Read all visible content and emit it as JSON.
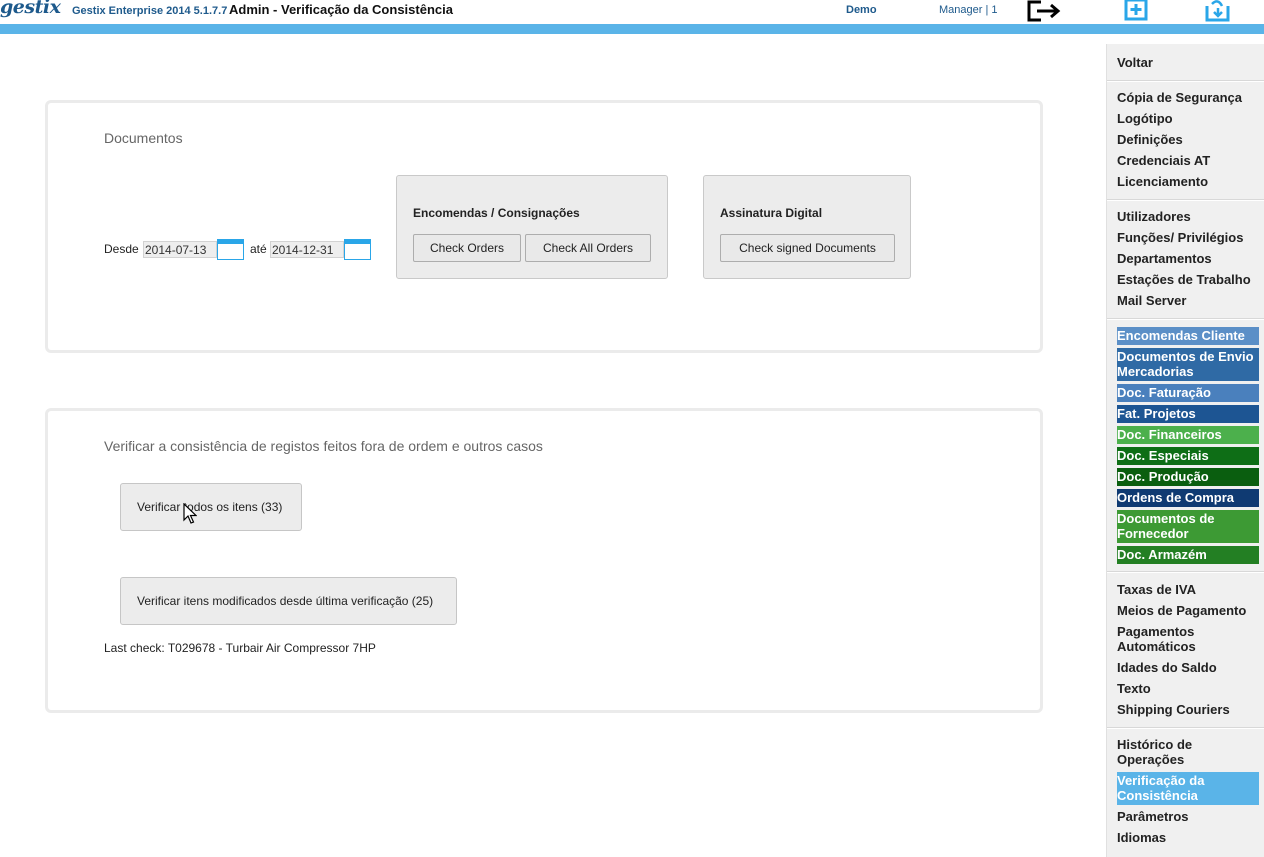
{
  "header": {
    "logo": "gestix",
    "app_version": "Gestix Enterprise 2014 5.1.7.7",
    "page_title": "Admin - Verificação da Consistência",
    "company": "Demo",
    "user": "Manager | 1",
    "icons": [
      "logout-icon",
      "new-window-icon",
      "sync-icon"
    ]
  },
  "documents_panel": {
    "title": "Documentos",
    "from_label": "Desde",
    "from_date": "2014-07-13",
    "to_label": "até",
    "to_date": "2014-12-31",
    "orders_group": {
      "title": "Encomendas / Consignações",
      "check_orders": "Check Orders",
      "check_all_orders": "Check All Orders"
    },
    "signature_group": {
      "title": "Assinatura Digital",
      "check_signed": "Check signed Documents"
    }
  },
  "consistency_panel": {
    "title": "Verificar a consistência de registos feitos fora de ordem e outros casos",
    "verify_all": "Verificar todos os itens (33)",
    "verify_modified": "Verificar itens modificados desde última verificação (25)",
    "last_check": "Last check: T029678 - Turbair Air Compressor 7HP"
  },
  "sidebar": {
    "back": "Voltar",
    "group1": [
      "Cópia de Segurança",
      "Logótipo",
      "Definições",
      "Credenciais AT",
      "Licenciamento"
    ],
    "group2": [
      "Utilizadores",
      "Funções/ Privilégios",
      "Departamentos",
      "Estações de Trabalho",
      "Mail Server"
    ],
    "group3": [
      {
        "label": "Encomendas Cliente",
        "color": "#5b8fc7"
      },
      {
        "label": "Documentos de Envio Mercadorias",
        "color": "#2f6aa5"
      },
      {
        "label": "Doc. Faturação",
        "color": "#4a80bd"
      },
      {
        "label": "Fat. Projetos",
        "color": "#1d5593"
      },
      {
        "label": "Doc. Financeiros",
        "color": "#4cb04c"
      },
      {
        "label": "Doc. Especiais",
        "color": "#0e6e16"
      },
      {
        "label": "Doc. Produção",
        "color": "#0a5e0f"
      },
      {
        "label": "Ordens de Compra",
        "color": "#0f3a72"
      },
      {
        "label": "Documentos de Fornecedor",
        "color": "#3d9a34"
      },
      {
        "label": "Doc. Armazém",
        "color": "#237f23"
      }
    ],
    "group4": [
      "Taxas de IVA",
      "Meios de Pagamento",
      "Pagamentos Automáticos",
      "Idades do Saldo",
      "Texto",
      "Shipping Couriers"
    ],
    "group5": [
      "Histórico de Operações",
      "Verificação da Consistência",
      "Parâmetros",
      "Idiomas"
    ],
    "active_color": "#5ab4e8"
  }
}
